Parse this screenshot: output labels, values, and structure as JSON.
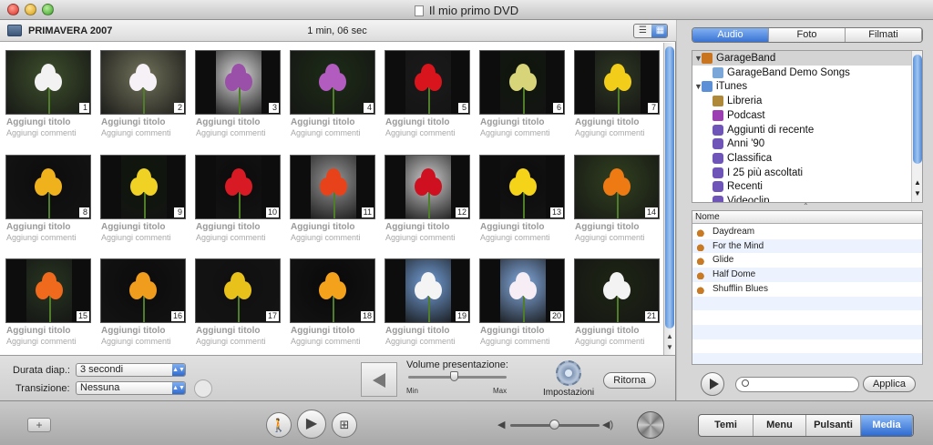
{
  "window": {
    "title": "Il mio primo DVD"
  },
  "browser": {
    "album": "PRIMAVERA 2007",
    "duration": "1 min, 06 sec"
  },
  "photos": [
    {
      "num": "1",
      "title": "Aggiungi titolo",
      "comment": "Aggiungi commenti",
      "bg": "#3a4a2a",
      "flower": "#f2f2f2"
    },
    {
      "num": "2",
      "title": "Aggiungi titolo",
      "comment": "Aggiungi commenti",
      "bg": "#6a6a55",
      "flower": "#f6f1f6"
    },
    {
      "num": "3",
      "title": "Aggiungi titolo",
      "comment": "Aggiungi commenti",
      "bg": "#c8c8c8",
      "flower": "#9a4fa8"
    },
    {
      "num": "4",
      "title": "Aggiungi titolo",
      "comment": "Aggiungi commenti",
      "bg": "#1c2a16",
      "flower": "#b25cc0"
    },
    {
      "num": "5",
      "title": "Aggiungi titolo",
      "comment": "Aggiungi commenti",
      "bg": "#1a1a1a",
      "flower": "#d8141c"
    },
    {
      "num": "6",
      "title": "Aggiungi titolo",
      "comment": "Aggiungi commenti",
      "bg": "#0f170c",
      "flower": "#d8d47a"
    },
    {
      "num": "7",
      "title": "Aggiungi titolo",
      "comment": "Aggiungi commenti",
      "bg": "#2c3522",
      "flower": "#f2cd1a"
    },
    {
      "num": "8",
      "title": "Aggiungi titolo",
      "comment": "Aggiungi commenti",
      "bg": "#0d0d0d",
      "flower": "#f0b21c"
    },
    {
      "num": "9",
      "title": "Aggiungi titolo",
      "comment": "Aggiungi commenti",
      "bg": "#0e160b",
      "flower": "#f0d224"
    },
    {
      "num": "10",
      "title": "Aggiungi titolo",
      "comment": "Aggiungi commenti",
      "bg": "#0c0c0c",
      "flower": "#d81a24"
    },
    {
      "num": "11",
      "title": "Aggiungi titolo",
      "comment": "Aggiungi commenti",
      "bg": "#8b8b8b",
      "flower": "#e8421a"
    },
    {
      "num": "12",
      "title": "Aggiungi titolo",
      "comment": "Aggiungi commenti",
      "bg": "#bdbdbd",
      "flower": "#cf1020"
    },
    {
      "num": "13",
      "title": "Aggiungi titolo",
      "comment": "Aggiungi commenti",
      "bg": "#0c0c0c",
      "flower": "#f4d318"
    },
    {
      "num": "14",
      "title": "Aggiungi titolo",
      "comment": "Aggiungi commenti",
      "bg": "#2e3c1e",
      "flower": "#ee7a14"
    },
    {
      "num": "15",
      "title": "Aggiungi titolo",
      "comment": "Aggiungi commenti",
      "bg": "#263320",
      "flower": "#ef6a1c"
    },
    {
      "num": "16",
      "title": "Aggiungi titolo",
      "comment": "Aggiungi commenti",
      "bg": "#0c0c0c",
      "flower": "#f09c1c"
    },
    {
      "num": "17",
      "title": "Aggiungi titolo",
      "comment": "Aggiungi commenti",
      "bg": "#101010",
      "flower": "#e8c21a"
    },
    {
      "num": "18",
      "title": "Aggiungi titolo",
      "comment": "Aggiungi commenti",
      "bg": "#0a0a0a",
      "flower": "#f4a21c"
    },
    {
      "num": "19",
      "title": "Aggiungi titolo",
      "comment": "Aggiungi commenti",
      "bg": "#6c94c8",
      "flower": "#f4f4f4"
    },
    {
      "num": "20",
      "title": "Aggiungi titolo",
      "comment": "Aggiungi commenti",
      "bg": "#7b9fd0",
      "flower": "#f6eef4"
    },
    {
      "num": "21",
      "title": "Aggiungi titolo",
      "comment": "Aggiungi commenti",
      "bg": "#1d2414",
      "flower": "#f3f3f3"
    }
  ],
  "settings": {
    "slide_duration_label": "Durata diap.:",
    "slide_duration_value": "3 secondi",
    "transition_label": "Transizione:",
    "transition_value": "Nessuna",
    "volume_label": "Volume presentazione:",
    "volume_min": "Min",
    "volume_max": "Max",
    "volume_level": 0.5,
    "settings_label": "Impostazioni",
    "back_label": "Ritorna"
  },
  "media": {
    "tabs": [
      {
        "label": "Audio",
        "active": true
      },
      {
        "label": "Foto",
        "active": false
      },
      {
        "label": "Filmati",
        "active": false
      }
    ],
    "sources": [
      {
        "label": "GarageBand",
        "level": 0,
        "expanded": true,
        "icon": "guitar-icon",
        "selected": true
      },
      {
        "label": "GarageBand Demo Songs",
        "level": 1,
        "icon": "folder-icon"
      },
      {
        "label": "iTunes",
        "level": 0,
        "expanded": true,
        "icon": "itunes-icon"
      },
      {
        "label": "Libreria",
        "level": 1,
        "icon": "library-icon"
      },
      {
        "label": "Podcast",
        "level": 1,
        "icon": "podcast-icon"
      },
      {
        "label": "Aggiunti di recente",
        "level": 1,
        "icon": "smart-playlist-icon"
      },
      {
        "label": "Anni '90",
        "level": 1,
        "icon": "smart-playlist-icon"
      },
      {
        "label": "Classifica",
        "level": 1,
        "icon": "smart-playlist-icon"
      },
      {
        "label": "I 25 più ascoltati",
        "level": 1,
        "icon": "smart-playlist-icon"
      },
      {
        "label": "Recenti",
        "level": 1,
        "icon": "smart-playlist-icon"
      },
      {
        "label": "Videoclip",
        "level": 1,
        "icon": "smart-playlist-icon"
      }
    ],
    "song_column": "Nome",
    "songs": [
      "Daydream",
      "For the Mind",
      "Glide",
      "Half Dome",
      "Shufflin Blues"
    ],
    "apply_label": "Applica"
  },
  "bottom": {
    "modes": [
      {
        "label": "Temi",
        "active": false
      },
      {
        "label": "Menu",
        "active": false
      },
      {
        "label": "Pulsanti",
        "active": false
      },
      {
        "label": "Media",
        "active": true
      }
    ],
    "add_label": "+"
  },
  "colors": {
    "accent": "#3a73d3",
    "selection": "#d4d4d4",
    "caption": "#9a9a9a"
  }
}
